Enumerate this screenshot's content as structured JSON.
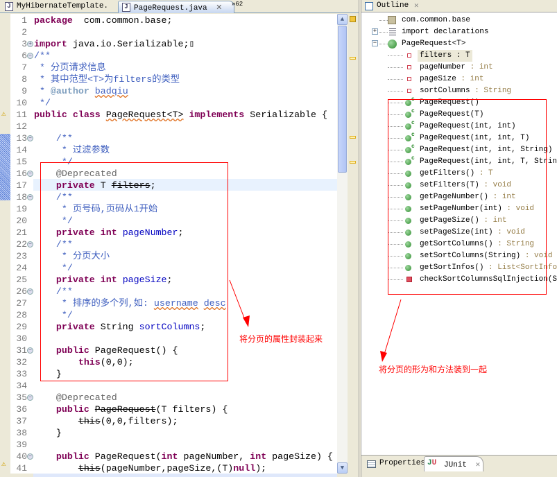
{
  "editor": {
    "tabs": [
      {
        "label": "MyHibernateTemplate.",
        "active": false
      },
      {
        "label": "PageRequest.java",
        "active": true
      }
    ],
    "overflow_label": "62",
    "lines": [
      {
        "n": "1",
        "fold": "",
        "t": [
          [
            "kw",
            "package"
          ],
          [
            "",
            "  com.common.base;"
          ]
        ]
      },
      {
        "n": "2",
        "fold": "",
        "t": []
      },
      {
        "n": "3",
        "fold": "+",
        "t": [
          [
            "kw",
            "import"
          ],
          [
            "",
            " java.io.Serializable;"
          ],
          [
            "",
            "▯"
          ]
        ]
      },
      {
        "n": "6",
        "fold": "-",
        "t": [
          [
            "cm",
            "/**"
          ]
        ]
      },
      {
        "n": "7",
        "fold": "",
        "t": [
          [
            "cm",
            " * 分页请求信息"
          ]
        ]
      },
      {
        "n": "8",
        "fold": "",
        "t": [
          [
            "cm",
            " * 其中范型<T>为filters的类型"
          ]
        ]
      },
      {
        "n": "9",
        "fold": "",
        "t": [
          [
            "cm",
            " * "
          ],
          [
            "tag",
            "@author"
          ],
          [
            "cm",
            " "
          ],
          [
            "cm sq",
            "badqiu"
          ]
        ]
      },
      {
        "n": "10",
        "fold": "",
        "t": [
          [
            "cm",
            " */"
          ]
        ]
      },
      {
        "n": "11",
        "fold": "",
        "t": [
          [
            "kw",
            "public class"
          ],
          [
            "",
            " "
          ],
          [
            "sq",
            "PageRequest<T>"
          ],
          [
            "",
            " "
          ],
          [
            "kw",
            "implements"
          ],
          [
            "",
            " Serializable {"
          ]
        ]
      },
      {
        "n": "12",
        "fold": "",
        "t": []
      },
      {
        "n": "13",
        "fold": "-",
        "t": [
          [
            "cm",
            "    /**"
          ]
        ]
      },
      {
        "n": "14",
        "fold": "",
        "t": [
          [
            "cm",
            "     * 过滤参数"
          ]
        ]
      },
      {
        "n": "15",
        "fold": "",
        "t": [
          [
            "cm",
            "     */"
          ]
        ]
      },
      {
        "n": "16",
        "fold": "-",
        "t": [
          [
            "ann",
            "    @Deprecated"
          ]
        ]
      },
      {
        "n": "17",
        "fold": "",
        "t": [
          [
            "",
            "    "
          ],
          [
            "kw",
            "private"
          ],
          [
            "",
            " T "
          ],
          [
            "st",
            "filters"
          ],
          [
            "",
            ";"
          ]
        ]
      },
      {
        "n": "18",
        "fold": "-",
        "t": [
          [
            "cm",
            "    /**"
          ]
        ]
      },
      {
        "n": "19",
        "fold": "",
        "t": [
          [
            "cm",
            "     * 页号码,页码从1开始"
          ]
        ]
      },
      {
        "n": "20",
        "fold": "",
        "t": [
          [
            "cm",
            "     */"
          ]
        ]
      },
      {
        "n": "21",
        "fold": "",
        "t": [
          [
            "",
            "    "
          ],
          [
            "kw",
            "private int"
          ],
          [
            "",
            " "
          ],
          [
            "fd",
            "pageNumber"
          ],
          [
            "",
            ";"
          ]
        ]
      },
      {
        "n": "22",
        "fold": "-",
        "t": [
          [
            "cm",
            "    /**"
          ]
        ]
      },
      {
        "n": "23",
        "fold": "",
        "t": [
          [
            "cm",
            "     * 分页大小"
          ]
        ]
      },
      {
        "n": "24",
        "fold": "",
        "t": [
          [
            "cm",
            "     */"
          ]
        ]
      },
      {
        "n": "25",
        "fold": "",
        "t": [
          [
            "",
            "    "
          ],
          [
            "kw",
            "private int"
          ],
          [
            "",
            " "
          ],
          [
            "fd",
            "pageSize"
          ],
          [
            "",
            ";"
          ]
        ]
      },
      {
        "n": "26",
        "fold": "-",
        "t": [
          [
            "cm",
            "    /**"
          ]
        ]
      },
      {
        "n": "27",
        "fold": "",
        "t": [
          [
            "cm",
            "     * 排序的多个列,如: "
          ],
          [
            "cm sq",
            "username"
          ],
          [
            "cm",
            " "
          ],
          [
            "cm sq",
            "desc"
          ]
        ]
      },
      {
        "n": "28",
        "fold": "",
        "t": [
          [
            "cm",
            "     */"
          ]
        ]
      },
      {
        "n": "29",
        "fold": "",
        "t": [
          [
            "",
            "    "
          ],
          [
            "kw",
            "private"
          ],
          [
            "",
            " String "
          ],
          [
            "fd",
            "sortColumns"
          ],
          [
            "",
            ";"
          ]
        ]
      },
      {
        "n": "30",
        "fold": "",
        "t": []
      },
      {
        "n": "31",
        "fold": "-",
        "t": [
          [
            "",
            "    "
          ],
          [
            "kw",
            "public"
          ],
          [
            "",
            " PageRequest() {"
          ]
        ]
      },
      {
        "n": "32",
        "fold": "",
        "t": [
          [
            "",
            "        "
          ],
          [
            "kw",
            "this"
          ],
          [
            "",
            "(0,0);"
          ]
        ]
      },
      {
        "n": "33",
        "fold": "",
        "t": [
          [
            "",
            "    }"
          ]
        ]
      },
      {
        "n": "34",
        "fold": "",
        "t": []
      },
      {
        "n": "35",
        "fold": "-",
        "t": [
          [
            "ann",
            "    @Deprecated"
          ]
        ]
      },
      {
        "n": "36",
        "fold": "",
        "t": [
          [
            "",
            "    "
          ],
          [
            "kw",
            "public"
          ],
          [
            "",
            " "
          ],
          [
            "st",
            "PageRequest"
          ],
          [
            "",
            "(T filters) {"
          ]
        ]
      },
      {
        "n": "37",
        "fold": "",
        "t": [
          [
            "",
            "        "
          ],
          [
            "st",
            "this"
          ],
          [
            "",
            "(0,0,filters);"
          ]
        ]
      },
      {
        "n": "38",
        "fold": "",
        "t": [
          [
            "",
            "    }"
          ]
        ]
      },
      {
        "n": "39",
        "fold": "",
        "t": []
      },
      {
        "n": "40",
        "fold": "-",
        "t": [
          [
            "",
            "    "
          ],
          [
            "kw",
            "public"
          ],
          [
            "",
            " PageRequest("
          ],
          [
            "kw",
            "int"
          ],
          [
            "",
            " pageNumber, "
          ],
          [
            "kw",
            "int"
          ],
          [
            "",
            " pageSize) {"
          ]
        ]
      },
      {
        "n": "41",
        "fold": "",
        "t": [
          [
            "",
            "        "
          ],
          [
            "st",
            "this"
          ],
          [
            "",
            "(pageNumber,pageSize,(T)"
          ],
          [
            "kw",
            "null"
          ],
          [
            "",
            ");"
          ]
        ]
      }
    ]
  },
  "outline": {
    "title": "Outline",
    "items": [
      {
        "label": "com.common.base",
        "type": "",
        "level": 0,
        "icon": "package-icon"
      },
      {
        "label": "import declarations",
        "type": "",
        "level": 0,
        "icon": "imports-icon"
      },
      {
        "label": "PageRequest<T>",
        "type": "",
        "level": 0,
        "icon": "class-icon"
      },
      {
        "label": "filters",
        "type": " : T",
        "level": 1,
        "icon": "field-icon"
      },
      {
        "label": "pageNumber",
        "type": " : int",
        "level": 1,
        "icon": "field-icon"
      },
      {
        "label": "pageSize",
        "type": " : int",
        "level": 1,
        "icon": "field-icon"
      },
      {
        "label": "sortColumns",
        "type": " : String",
        "level": 1,
        "icon": "field-icon"
      },
      {
        "label": "PageRequest()",
        "type": "",
        "level": 1,
        "icon": "constructor-icon"
      },
      {
        "label": "PageRequest(T)",
        "type": "",
        "level": 1,
        "icon": "constructor-icon"
      },
      {
        "label": "PageRequest(int, int)",
        "type": "",
        "level": 1,
        "icon": "constructor-icon"
      },
      {
        "label": "PageRequest(int, int, T)",
        "type": "",
        "level": 1,
        "icon": "constructor-icon"
      },
      {
        "label": "PageRequest(int, int, String)",
        "type": "",
        "level": 1,
        "icon": "constructor-icon"
      },
      {
        "label": "PageRequest(int, int, T, String)",
        "type": "",
        "level": 1,
        "icon": "constructor-icon"
      },
      {
        "label": "getFilters()",
        "type": " : T",
        "level": 1,
        "icon": "method-icon"
      },
      {
        "label": "setFilters(T)",
        "type": " : void",
        "level": 1,
        "icon": "method-icon"
      },
      {
        "label": "getPageNumber()",
        "type": " : int",
        "level": 1,
        "icon": "method-icon"
      },
      {
        "label": "setPageNumber(int)",
        "type": " : void",
        "level": 1,
        "icon": "method-icon"
      },
      {
        "label": "getPageSize()",
        "type": " : int",
        "level": 1,
        "icon": "method-icon"
      },
      {
        "label": "setPageSize(int)",
        "type": " : void",
        "level": 1,
        "icon": "method-icon"
      },
      {
        "label": "getSortColumns()",
        "type": " : String",
        "level": 1,
        "icon": "method-icon"
      },
      {
        "label": "setSortColumns(String)",
        "type": " : void",
        "level": 1,
        "icon": "method-icon"
      },
      {
        "label": "getSortInfos()",
        "type": " : List<SortInfo>",
        "level": 1,
        "icon": "method-icon"
      },
      {
        "label": "checkSortColumnsSqlInjection(String)",
        "type": "",
        "level": 1,
        "icon": "private-method-icon"
      }
    ]
  },
  "bottom_tabs": [
    {
      "label": "Properties"
    },
    {
      "label": "JUnit"
    }
  ],
  "annotations": {
    "editor_note": "将分页的属性封装起来",
    "outline_note": "将分页的形为和方法装到一起",
    "color": "#ff0000"
  }
}
